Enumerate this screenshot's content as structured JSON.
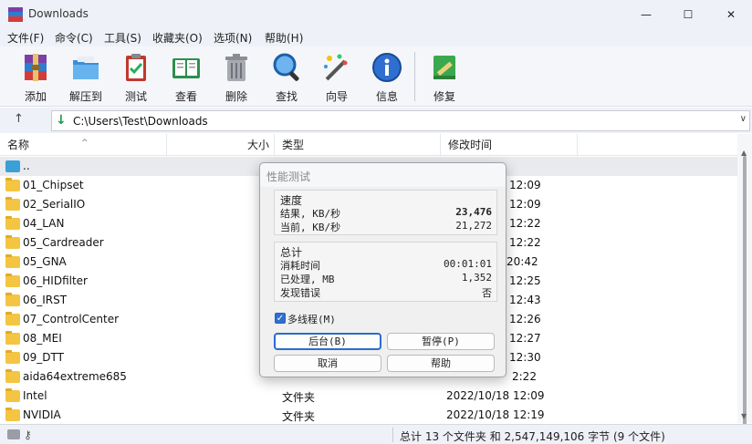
{
  "window": {
    "title": "Downloads",
    "controls": {
      "minimize": "—",
      "maximize": "☐",
      "close": "✕"
    }
  },
  "menu": [
    "文件(F)",
    "命令(C)",
    "工具(S)",
    "收藏夹(O)",
    "选项(N)",
    "帮助(H)"
  ],
  "toolbar": [
    {
      "label": "添加",
      "icon": "add-archive-icon"
    },
    {
      "label": "解压到",
      "icon": "extract-folder-icon"
    },
    {
      "label": "测试",
      "icon": "test-clipboard-icon"
    },
    {
      "label": "查看",
      "icon": "view-book-icon"
    },
    {
      "label": "删除",
      "icon": "trash-icon"
    },
    {
      "label": "查找",
      "icon": "magnifier-icon"
    },
    {
      "label": "向导",
      "icon": "wizard-wand-icon"
    },
    {
      "label": "信息",
      "icon": "info-icon"
    },
    {
      "label": "修复",
      "icon": "repair-icon"
    }
  ],
  "address": {
    "up": "↑",
    "icon": "↓",
    "path": "C:\\Users\\Test\\Downloads",
    "dropdown": "∨"
  },
  "columns": {
    "name": "名称",
    "size": "大小",
    "type": "类型",
    "modified": "修改时间",
    "sort_indicator": "^"
  },
  "files": [
    {
      "name": "..",
      "type": "",
      "modified": "",
      "kind": "parent"
    },
    {
      "name": "01_Chipset",
      "type": "",
      "modified": "12:09",
      "kind": "folder"
    },
    {
      "name": "02_SerialIO",
      "type": "",
      "modified": "12:09",
      "kind": "folder"
    },
    {
      "name": "04_LAN",
      "type": "",
      "modified": "12:22",
      "kind": "folder"
    },
    {
      "name": "05_Cardreader",
      "type": "",
      "modified": "12:22",
      "kind": "folder"
    },
    {
      "name": "05_GNA",
      "type": "",
      "modified": "20:42",
      "kind": "folder"
    },
    {
      "name": "06_HIDfilter",
      "type": "",
      "modified": "12:25",
      "kind": "folder"
    },
    {
      "name": "06_IRST",
      "type": "",
      "modified": "12:43",
      "kind": "folder"
    },
    {
      "name": "07_ControlCenter",
      "type": "",
      "modified": "12:26",
      "kind": "folder"
    },
    {
      "name": "08_MEI",
      "type": "",
      "modified": "12:27",
      "kind": "folder"
    },
    {
      "name": "09_DTT",
      "type": "",
      "modified": "12:30",
      "kind": "folder"
    },
    {
      "name": "aida64extreme685",
      "type": "",
      "modified": "2:22",
      "kind": "folder"
    },
    {
      "name": "Intel",
      "type": "文件夹",
      "modified": "2022/10/18 12:09",
      "kind": "folder"
    },
    {
      "name": "NVIDIA",
      "type": "文件夹",
      "modified": "2022/10/18 12:19",
      "kind": "folder"
    }
  ],
  "status": {
    "text": "总计 13 个文件夹 和 2,547,149,106 字节 (9 个文件)"
  },
  "dialog": {
    "title": "性能测试",
    "speed": {
      "title": "速度",
      "result_label": "结果, KB/秒",
      "result_value": "23,476",
      "current_label": "当前, KB/秒",
      "current_value": "21,272"
    },
    "total": {
      "title": "总计",
      "elapsed_label": "消耗时间",
      "elapsed_value": "00:01:01",
      "processed_label": "已处理, MB",
      "processed_value": "1,352",
      "errors_label": "发现错误",
      "errors_value": "否"
    },
    "multithread": {
      "label": "多线程(M)",
      "checked": true,
      "mark": "✓"
    },
    "buttons": {
      "background": "后台(B)",
      "pause": "暂停(P)",
      "cancel": "取消",
      "help": "帮助"
    }
  },
  "colors": {
    "accent": "#2c6bd0",
    "folder": "#f4c542"
  }
}
